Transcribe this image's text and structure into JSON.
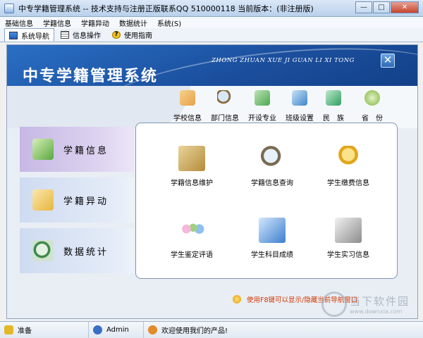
{
  "window": {
    "title": "中专学籍管理系统 -- 技术支持与注册正版联系QQ 510000118   当前版本：(非注册版)",
    "minimize": "—",
    "maximize": "□",
    "close": "✕"
  },
  "menu": [
    "基础信息",
    "学籍信息",
    "学籍异动",
    "数据统计",
    "系统(S)"
  ],
  "tabs": [
    {
      "label": "系统导航",
      "icon": "monitor-icon"
    },
    {
      "label": "信息操作",
      "icon": "grid-icon"
    },
    {
      "label": "使用指南",
      "icon": "help-icon"
    }
  ],
  "banner": {
    "title": "中专学籍管理系统",
    "pinyin": "ZHONG ZHUAN XUE JI GUAN LI XI TONG",
    "close": "✕"
  },
  "top_nav": [
    {
      "label": "学校信息",
      "icon": "school-icon",
      "color": "#e7a24a"
    },
    {
      "label": "部门信息",
      "icon": "magnifier-icon",
      "color": "#8a6b3c"
    },
    {
      "label": "开设专业",
      "icon": "book-icon",
      "color": "#4aa84e"
    },
    {
      "label": "班级设置",
      "icon": "open-book-icon",
      "color": "#3f86c9"
    },
    {
      "label": "民　族",
      "icon": "flag-icon",
      "color": "#2f9f5e"
    },
    {
      "label": "省　份",
      "icon": "globe-icon",
      "color": "#7fb43a"
    }
  ],
  "left_menu": [
    {
      "label": "学籍信息",
      "icon": "binders-icon",
      "active": true,
      "color": "#5aa83f"
    },
    {
      "label": "学籍异动",
      "icon": "folder-arrow-icon",
      "active": false,
      "color": "#e7b63d"
    },
    {
      "label": "数据统计",
      "icon": "search-data-icon",
      "active": false,
      "color": "#3e8b4a"
    }
  ],
  "panel": [
    {
      "label": "学籍信息维护",
      "icon": "notebook-icon",
      "color": "#b58b3a"
    },
    {
      "label": "学籍信息查询",
      "icon": "magnifier-icon",
      "color": "#7a6a52"
    },
    {
      "label": "学生缴费信息",
      "icon": "user-coins-icon",
      "color": "#e2a51a"
    },
    {
      "label": "学生鉴定评语",
      "icon": "people-icon",
      "color": "#c663a8"
    },
    {
      "label": "学生科目成绩",
      "icon": "folder-docs-icon",
      "color": "#3c7fcf"
    },
    {
      "label": "学生实习信息",
      "icon": "tools-icon",
      "color": "#8c8c8c"
    }
  ],
  "hint": "使用F8键可以显示/隐藏当前导航窗口",
  "status": [
    {
      "text": "准备",
      "icon": "ready-icon",
      "color": "#e3b826"
    },
    {
      "text": "Admin",
      "icon": "user-icon",
      "color": "#3a6fc4"
    },
    {
      "text": "欢迎使用我们的产品!",
      "icon": "users-icon",
      "color": "#e28c2a"
    }
  ],
  "watermark": {
    "name": "当下软件园",
    "url": "www.downxia.com"
  }
}
